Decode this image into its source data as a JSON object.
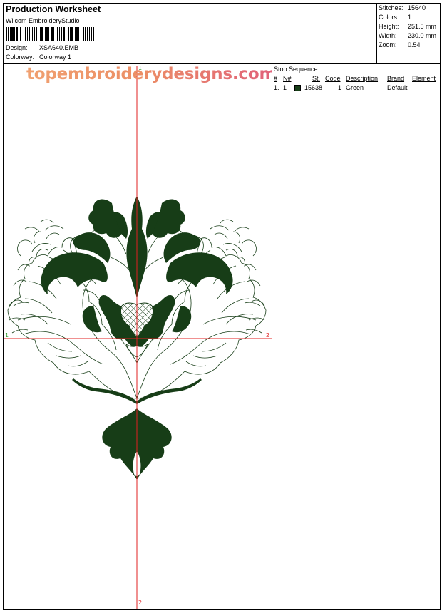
{
  "header": {
    "title": "Production Worksheet",
    "software": "Wilcom EmbroideryStudio",
    "design_label": "Design:",
    "design_value": "XSA640.EMB",
    "colorway_label": "Colorway:",
    "colorway_value": "Colorway 1"
  },
  "stats": {
    "stitches_label": "Stitches:",
    "stitches_value": "15640",
    "colors_label": "Colors:",
    "colors_value": "1",
    "height_label": "Height:",
    "height_value": "251.5 mm",
    "width_label": "Width:",
    "width_value": "230.0 mm",
    "zoom_label": "Zoom:",
    "zoom_value": "0.54"
  },
  "watermark": "topembroiderydesigns.com",
  "axes": {
    "top": "1",
    "left": "1",
    "right": "2",
    "bottom": "2",
    "color": "#e02020"
  },
  "design_color": "#173d17",
  "stop_sequence": {
    "title": "Stop Sequence:",
    "headers": {
      "num": "#",
      "nnum": "N#",
      "st": "St.",
      "code": "Code",
      "description": "Description",
      "brand": "Brand",
      "element": "Element"
    },
    "rows": [
      {
        "num": "1.",
        "nnum": "1",
        "color": "#173d17",
        "st": "15638",
        "code": "1",
        "description": "Green",
        "brand": "Default",
        "element": ""
      }
    ]
  }
}
